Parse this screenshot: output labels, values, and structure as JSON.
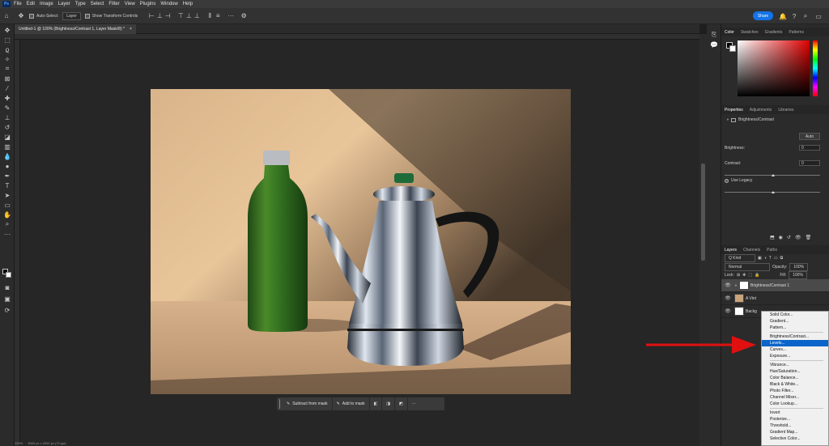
{
  "app": {
    "logo": "Ps",
    "menu": [
      "File",
      "Edit",
      "Image",
      "Layer",
      "Type",
      "Select",
      "Filter",
      "View",
      "Plugins",
      "Window",
      "Help"
    ]
  },
  "options": {
    "auto_select_label": "Auto-Select:",
    "layer_select": "Layer",
    "show_transform_label": "Show Transform Controls",
    "share_label": "Share"
  },
  "document": {
    "tab_title": "Untitled-1 @ 100% (Brightness/Contrast 1, Layer Mask/8) *",
    "close_glyph": "×"
  },
  "context_bar": {
    "subtract_label": "Subtract from mask",
    "add_label": "Add to mask",
    "more": "···"
  },
  "color_panel": {
    "tabs": [
      "Color",
      "Swatches",
      "Gradients",
      "Patterns"
    ]
  },
  "properties": {
    "tabs": [
      "Properties",
      "Adjustments",
      "Libraries"
    ],
    "adjustment_name": "Brightness/Contrast",
    "auto_label": "Auto",
    "brightness_label": "Brightness:",
    "brightness_value": "0",
    "contrast_label": "Contrast:",
    "contrast_value": "0",
    "use_legacy_label": "Use Legacy"
  },
  "layers": {
    "tabs": [
      "Layers",
      "Channels",
      "Paths"
    ],
    "filter_label": "Q Kind",
    "blend_mode": "Normal",
    "opacity_label": "Opacity:",
    "opacity_value": "100%",
    "lock_label": "Lock:",
    "fill_label": "Fill:",
    "fill_value": "100%",
    "rows": [
      {
        "name": "Brightness/Contrast 1"
      },
      {
        "name": "A Vint"
      },
      {
        "name": "Backg"
      }
    ]
  },
  "adjustment_menu": {
    "group1": [
      "Solid Color...",
      "Gradient...",
      "Pattern..."
    ],
    "group2": [
      "Brightness/Contrast...",
      "Levels...",
      "Curves...",
      "Exposure..."
    ],
    "group3": [
      "Vibrance...",
      "Hue/Saturation...",
      "Color Balance...",
      "Black & White...",
      "Photo Filter...",
      "Channel Mixer...",
      "Color Lookup..."
    ],
    "group4": [
      "Invert",
      "Posterize...",
      "Threshold...",
      "Gradient Map...",
      "Selective Color..."
    ],
    "highlighted": "Levels..."
  },
  "status": {
    "zoom": "100%",
    "doc_info": "3000 px x 2000 px (72 ppi)"
  },
  "colors": {
    "accent": "#1473e6",
    "highlight": "#0a64c9",
    "arrow": "#e01010"
  }
}
